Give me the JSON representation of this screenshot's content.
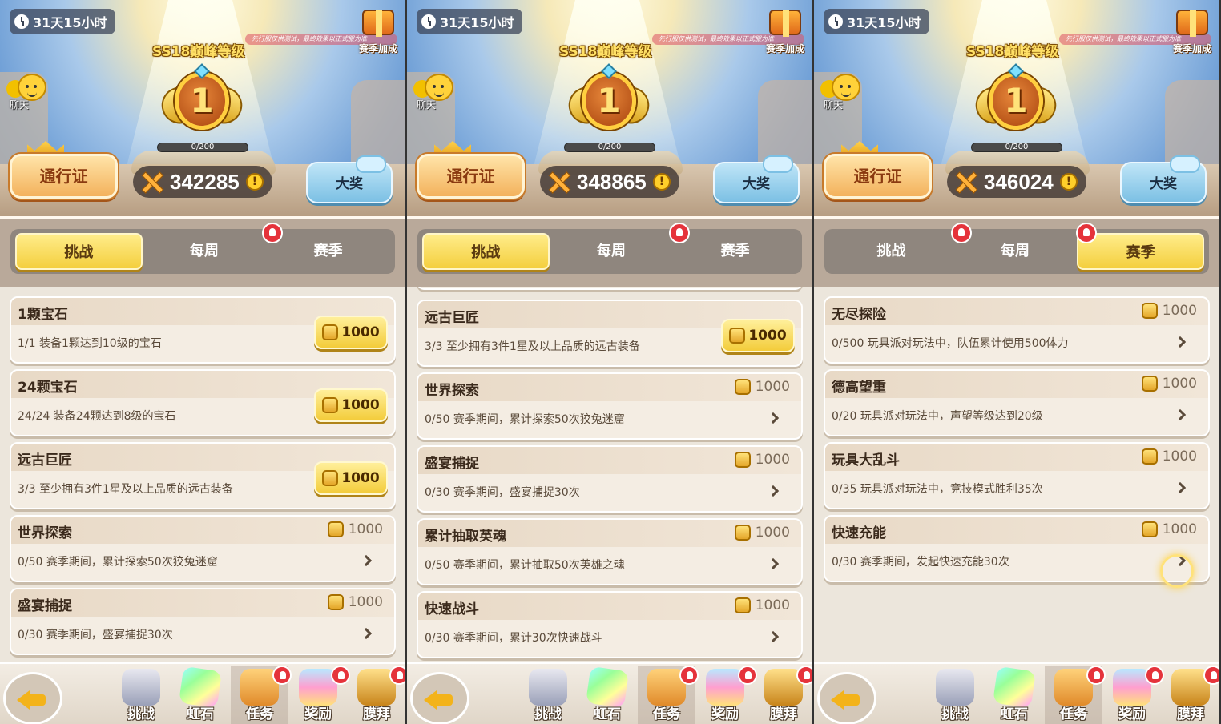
{
  "panels": [
    {
      "timer": "31天15小时",
      "season_title": "SS18巅峰等级",
      "test_notice": "先行服仅供测试，最终效果以正式服为准",
      "bonus_label": "赛季加成",
      "chat_label": "聊天",
      "rank": "1",
      "progress_text": "0/200",
      "progress_value": 0,
      "pass_label": "通行证",
      "score": "342285",
      "grand_prize_label": "大奖",
      "tabs": [
        "挑战",
        "每周",
        "赛季"
      ],
      "active_tab": 0,
      "tab_badges": [
        1
      ],
      "tasks": [
        {
          "title": "1颗宝石",
          "desc": "1/1 装备1颗达到10级的宝石",
          "reward": "1000",
          "claimable": true
        },
        {
          "title": "24颗宝石",
          "desc": "24/24 装备24颗达到8级的宝石",
          "reward": "1000",
          "claimable": true
        },
        {
          "title": "远古巨匠",
          "desc": "3/3 至少拥有3件1星及以上品质的远古装备",
          "reward": "1000",
          "claimable": true
        },
        {
          "title": "世界探索",
          "desc": "0/50 赛季期间，累计探索50次狡兔迷窟",
          "reward": "1000",
          "claimable": false
        },
        {
          "title": "盛宴捕捉",
          "desc": "0/30 赛季期间，盛宴捕捉30次",
          "reward": "1000",
          "claimable": false
        }
      ],
      "list_offset": 0
    },
    {
      "timer": "31天15小时",
      "season_title": "SS18巅峰等级",
      "test_notice": "先行服仅供测试，最终效果以正式服为准",
      "bonus_label": "赛季加成",
      "chat_label": "聊天",
      "rank": "1",
      "progress_text": "0/200",
      "progress_value": 0,
      "pass_label": "通行证",
      "score": "348865",
      "grand_prize_label": "大奖",
      "tabs": [
        "挑战",
        "每周",
        "赛季"
      ],
      "active_tab": 0,
      "tab_badges": [
        1
      ],
      "tasks": [
        {
          "title": "远古巨匠",
          "desc": "3/3 至少拥有3件1星及以上品质的远古装备",
          "reward": "1000",
          "claimable": true
        },
        {
          "title": "世界探索",
          "desc": "0/50 赛季期间，累计探索50次狡兔迷窟",
          "reward": "1000",
          "claimable": false
        },
        {
          "title": "盛宴捕捉",
          "desc": "0/30 赛季期间，盛宴捕捉30次",
          "reward": "1000",
          "claimable": false
        },
        {
          "title": "累计抽取英魂",
          "desc": "0/50 赛季期间，累计抽取50次英雄之魂",
          "reward": "1000",
          "claimable": false
        },
        {
          "title": "快速战斗",
          "desc": "0/30 赛季期间，累计30次快速战斗",
          "reward": "1000",
          "claimable": false
        }
      ],
      "list_offset": 1
    },
    {
      "timer": "31天15小时",
      "season_title": "SS18巅峰等级",
      "test_notice": "先行服仅供测试，最终效果以正式服为准",
      "bonus_label": "赛季加成",
      "chat_label": "聊天",
      "rank": "1",
      "progress_text": "0/200",
      "progress_value": 0,
      "pass_label": "通行证",
      "score": "346024",
      "grand_prize_label": "大奖",
      "tabs": [
        "挑战",
        "每周",
        "赛季"
      ],
      "active_tab": 2,
      "tab_badges": [
        0,
        1
      ],
      "tasks": [
        {
          "title": "无尽探险",
          "desc": "0/500 玩具派对玩法中，队伍累计使用500体力",
          "reward": "1000",
          "claimable": false
        },
        {
          "title": "德高望重",
          "desc": "0/20 玩具派对玩法中，声望等级达到20级",
          "reward": "1000",
          "claimable": false
        },
        {
          "title": "玩具大乱斗",
          "desc": "0/35 玩具派对玩法中，竞技模式胜利35次",
          "reward": "1000",
          "claimable": false
        },
        {
          "title": "快速充能",
          "desc": "0/30 赛季期间，发起快速充能30次",
          "reward": "1000",
          "claimable": false
        }
      ],
      "list_offset": 0
    }
  ],
  "nav": [
    {
      "label": "挑战",
      "icon": "crossed-swords-icon",
      "badge": false
    },
    {
      "label": "虹石",
      "icon": "rainbow-gem-icon",
      "badge": false
    },
    {
      "label": "任务",
      "icon": "task-scroll-icon",
      "badge": true
    },
    {
      "label": "奖励",
      "icon": "gift-box-icon",
      "badge": true
    },
    {
      "label": "膜拜",
      "icon": "treasure-chest-icon",
      "badge": true
    }
  ],
  "nav_selected": 2,
  "colors": {
    "accent_yellow": "#f4cf3e",
    "badge_red": "#e5333b",
    "tab_bar": "#8f867e"
  }
}
